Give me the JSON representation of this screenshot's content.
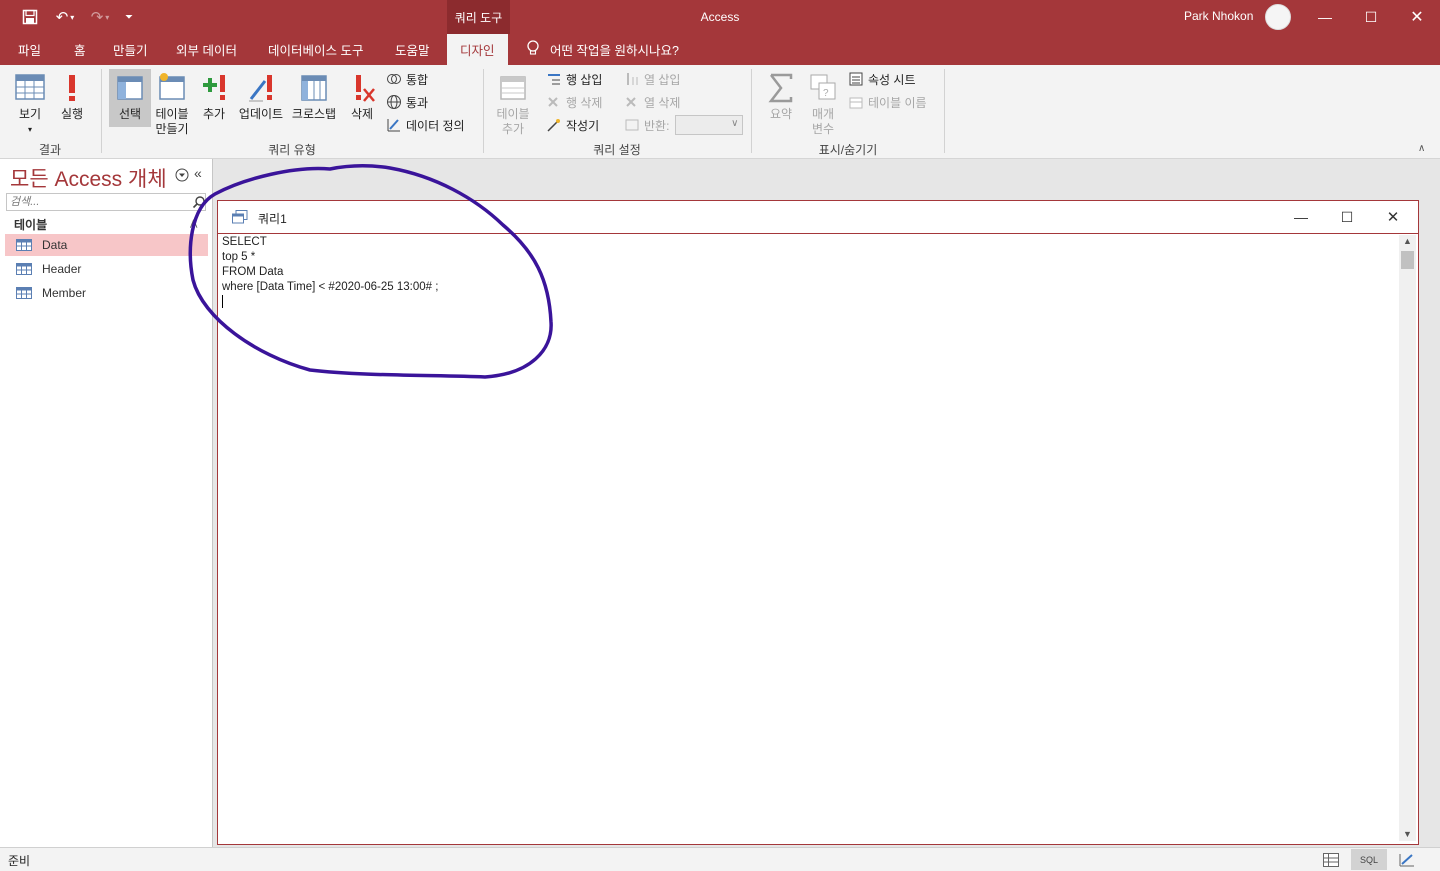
{
  "window": {
    "context_tab": "쿼리 도구",
    "app_title": "Access",
    "user_name": "Park Nhokon"
  },
  "menu": {
    "items": [
      "파일",
      "홈",
      "만들기",
      "외부 데이터",
      "데이터베이스 도구",
      "도움말",
      "디자인"
    ],
    "active": "디자인",
    "tell_me": "어떤 작업을 원하시나요?"
  },
  "ribbon": {
    "results": {
      "view": "보기",
      "run": "실행",
      "label": "결과"
    },
    "query_type": {
      "select": "선택",
      "make_table_1": "테이블",
      "make_table_2": "만들기",
      "append": "추가",
      "update": "업데이트",
      "crosstab": "크로스탭",
      "delete": "삭제",
      "union": "통합",
      "pass_through": "통과",
      "data_definition": "데이터 정의",
      "label": "쿼리 유형"
    },
    "query_setup": {
      "show_table_1": "테이블",
      "show_table_2": "추가",
      "insert_rows": "행 삽입",
      "delete_rows": "행 삭제",
      "builder": "작성기",
      "insert_columns": "열 삽입",
      "delete_columns": "열 삭제",
      "return": "반환:",
      "label": "쿼리 설정"
    },
    "show_hide": {
      "totals": "요약",
      "parameters_1": "매개",
      "parameters_2": "변수",
      "property_sheet": "속성 시트",
      "table_names": "테이블 이름",
      "label": "표시/숨기기"
    }
  },
  "nav": {
    "title": "모든 Access 개체",
    "search_placeholder": "검색...",
    "section": "테이블",
    "items": [
      "Data",
      "Header",
      "Member"
    ],
    "selected": "Data"
  },
  "query_window": {
    "title": "쿼리1",
    "sql_lines": [
      "SELECT",
      "top 5 *",
      "FROM Data",
      "where [Data Time] < #2020-06-25 13:00# ;"
    ]
  },
  "status": {
    "text": "준비",
    "sql_view": "SQL"
  },
  "colors": {
    "accent": "#a4373a",
    "annotation": "#3a149a",
    "selected_nav": "#f7c6c8"
  }
}
